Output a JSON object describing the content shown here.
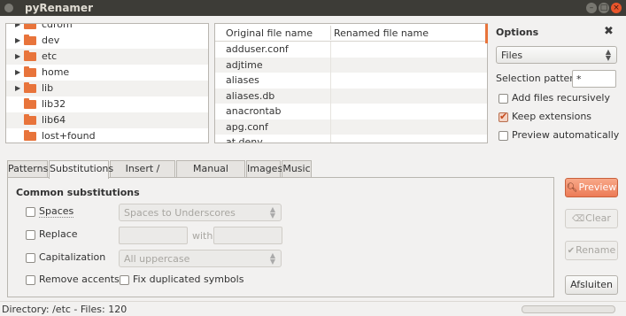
{
  "window": {
    "title": "pyRenamer"
  },
  "tree": {
    "items": [
      {
        "label": "cdrom",
        "expandable": true
      },
      {
        "label": "dev",
        "expandable": true
      },
      {
        "label": "etc",
        "expandable": true,
        "selected": true
      },
      {
        "label": "home",
        "expandable": true
      },
      {
        "label": "lib",
        "expandable": true
      },
      {
        "label": "lib32",
        "expandable": false
      },
      {
        "label": "lib64",
        "expandable": false
      },
      {
        "label": "lost+found",
        "expandable": false
      }
    ]
  },
  "files": {
    "columns": [
      "Original file name",
      "Renamed file name"
    ],
    "rows": [
      {
        "original": "adduser.conf",
        "renamed": ""
      },
      {
        "original": "adjtime",
        "renamed": ""
      },
      {
        "original": "aliases",
        "renamed": ""
      },
      {
        "original": "aliases.db",
        "renamed": ""
      },
      {
        "original": "anacrontab",
        "renamed": ""
      },
      {
        "original": "apg.conf",
        "renamed": ""
      },
      {
        "original": "at.deny",
        "renamed": ""
      }
    ]
  },
  "options": {
    "title": "Options",
    "type_value": "Files",
    "selection_pattern_label": "Selection pattern",
    "selection_pattern_value": "*",
    "add_recursive_label": "Add files recursively",
    "add_recursive_checked": false,
    "keep_extensions_label": "Keep extensions",
    "keep_extensions_checked": true,
    "preview_auto_label": "Preview automatically",
    "preview_auto_checked": false
  },
  "tabs": [
    "Patterns",
    "Substitutions",
    "Insert / Delete",
    "Manual rename",
    "Images",
    "Music"
  ],
  "active_tab": "Substitutions",
  "substitutions": {
    "section_title": "Common substitutions",
    "spaces_label": "Spaces",
    "spaces_option": "Spaces to Underscores",
    "replace_label": "Replace",
    "with_label": "with",
    "capitalization_label": "Capitalization",
    "capitalization_option": "All uppercase",
    "remove_accents_label": "Remove accents",
    "fix_duplicated_label": "Fix duplicated symbols"
  },
  "buttons": {
    "preview": "Preview",
    "clear": "Clear",
    "rename": "Rename",
    "quit": "Afsluiten"
  },
  "status": {
    "text": "Directory: /etc - Files: 120"
  },
  "colors": {
    "accent": "#e8743b",
    "titlebar": "#3d3c37",
    "close_button": "#e9552b"
  }
}
